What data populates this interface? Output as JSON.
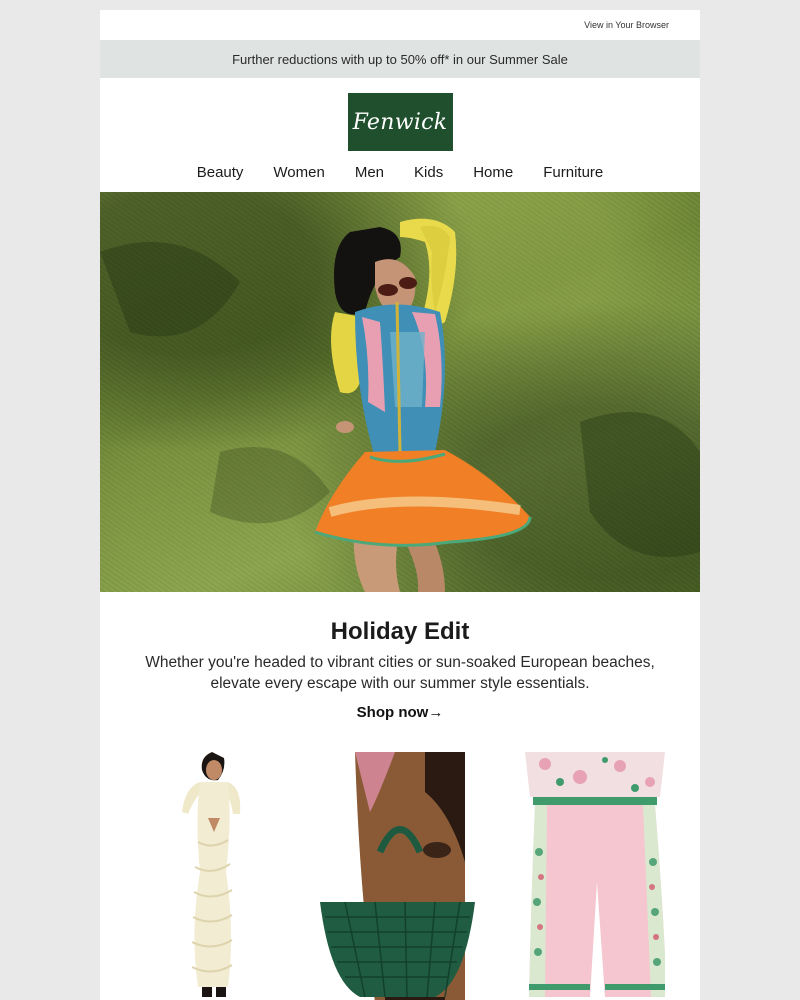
{
  "topbar": {
    "view_in_browser": "View in Your Browser"
  },
  "promo": {
    "text": "Further reductions with up to 50% off* in our Summer Sale"
  },
  "brand": {
    "logo_text": "Fenwick",
    "logo_color": "#1f4f2c"
  },
  "nav": {
    "items": [
      {
        "label": "Beauty"
      },
      {
        "label": "Women"
      },
      {
        "label": "Men"
      },
      {
        "label": "Kids"
      },
      {
        "label": "Home"
      },
      {
        "label": "Furniture"
      }
    ]
  },
  "hero": {
    "title": "Holiday Edit",
    "body": "Whether you're headed to vibrant cities or sun-soaked European beaches, elevate every escape with our summer style essentials.",
    "cta": "Shop now→"
  },
  "products": [
    {
      "name": "cream-ruffle-maxi-dress"
    },
    {
      "name": "green-woven-tote-bag"
    },
    {
      "name": "pink-printed-trousers"
    }
  ]
}
